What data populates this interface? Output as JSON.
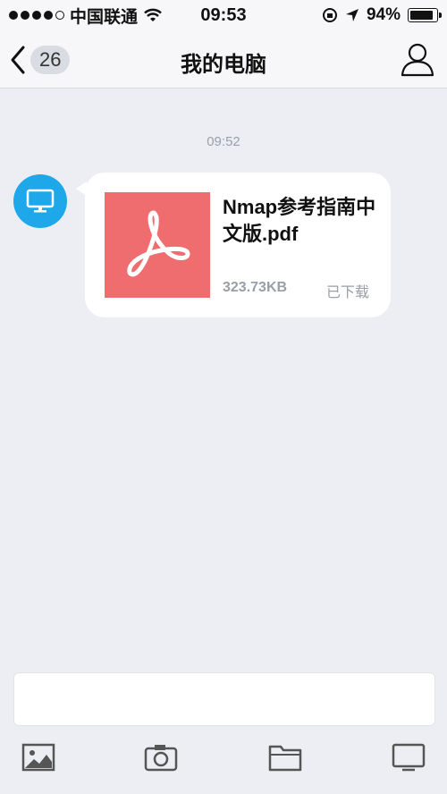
{
  "status_bar": {
    "carrier": "中国联通",
    "time": "09:53",
    "battery_percent": "94%",
    "battery_level": 0.94
  },
  "nav": {
    "back_badge": "26",
    "title": "我的电脑"
  },
  "conversation": {
    "timestamp": "09:52",
    "message": {
      "file_name": "Nmap参考指南中文版.pdf",
      "file_size": "323.73KB",
      "status": "已下载"
    }
  },
  "colors": {
    "accent": "#1ea8e9",
    "pdf_thumb": "#ef6d6f",
    "background": "#eceef3"
  },
  "toolbar": {
    "icons": [
      "image-icon",
      "camera-icon",
      "folder-icon",
      "screen-icon"
    ]
  }
}
